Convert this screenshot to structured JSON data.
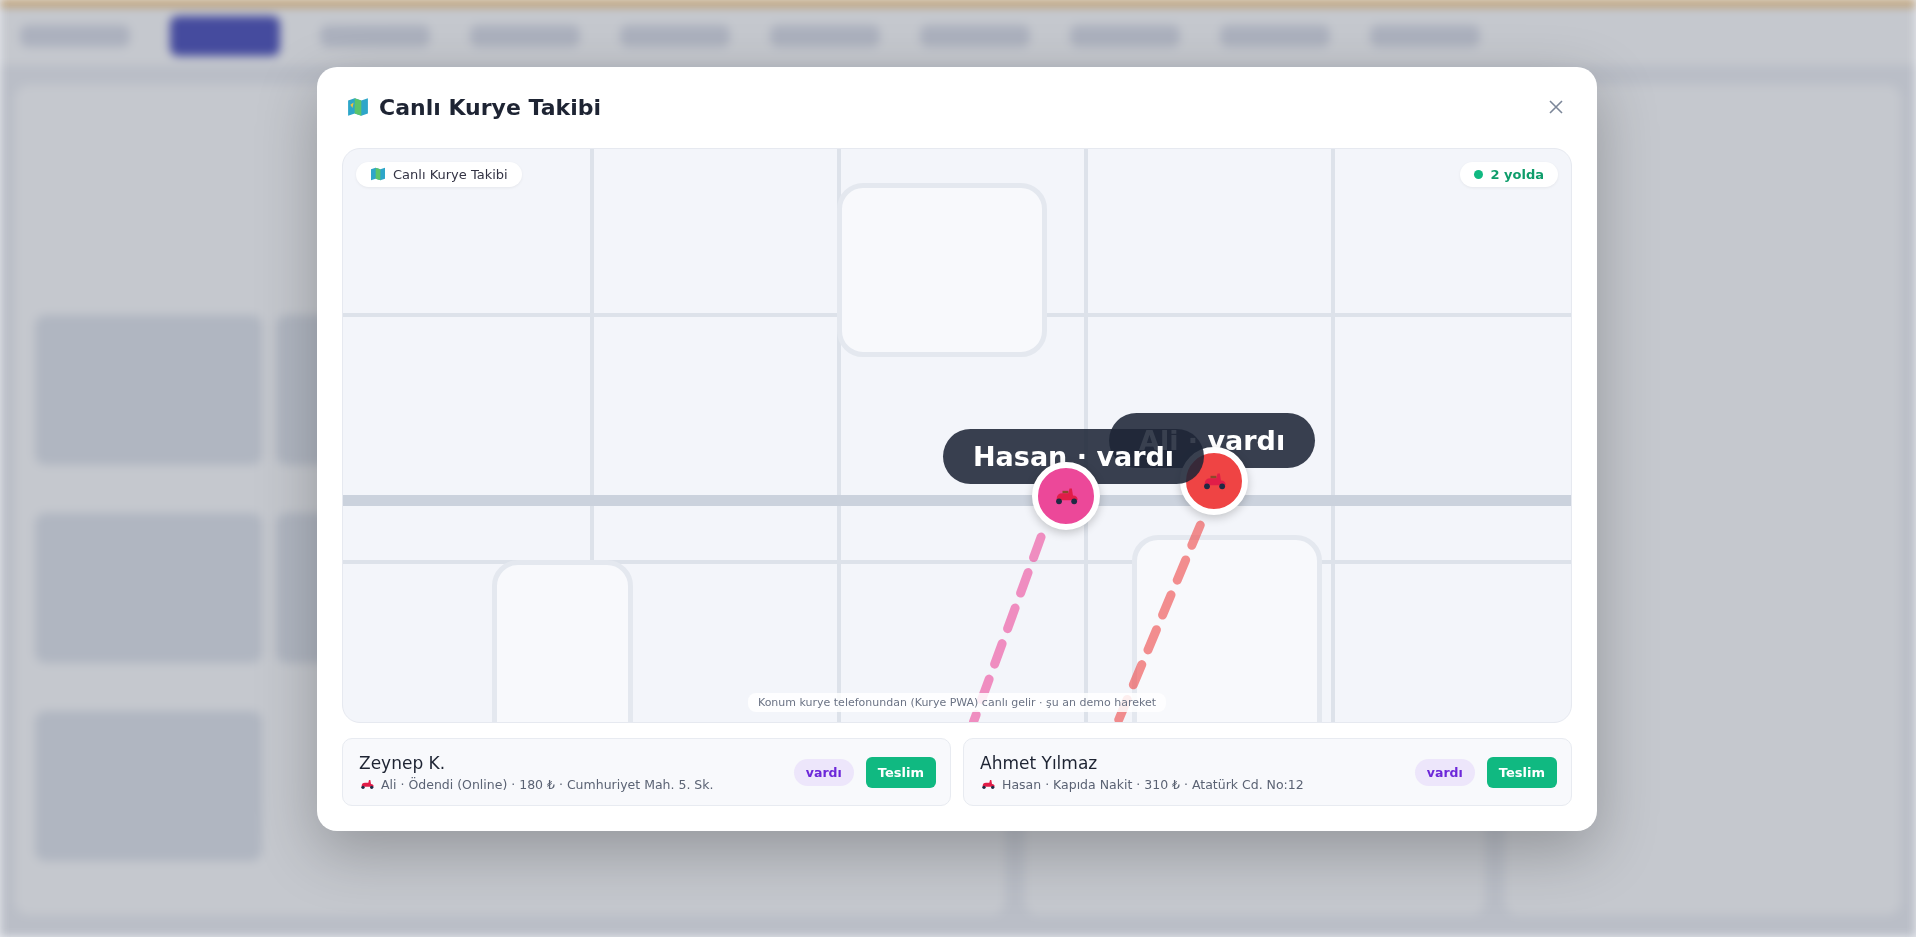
{
  "modal": {
    "title": "Canlı Kurye Takibi"
  },
  "map": {
    "badge": "Canlı Kurye Takibi",
    "status": "2 yolda",
    "caption": "Konum kurye telefonundan (Kurye PWA) canlı gelir · şu an demo hareket",
    "couriers": [
      {
        "label": "Ali · vardı",
        "color": "#ef4444"
      },
      {
        "label": "Hasan · vardı",
        "color": "#ec4899"
      }
    ]
  },
  "orders": [
    {
      "customer": "Zeynep K.",
      "details": "Ali · Ödendi (Online) · 180 ₺ · Cumhuriyet Mah. 5. Sk.",
      "status": "vardı",
      "action": "Teslim"
    },
    {
      "customer": "Ahmet Yılmaz",
      "details": "Hasan · Kapıda Nakit · 310 ₺ · Atatürk Cd. No:12",
      "status": "vardı",
      "action": "Teslim"
    }
  ]
}
